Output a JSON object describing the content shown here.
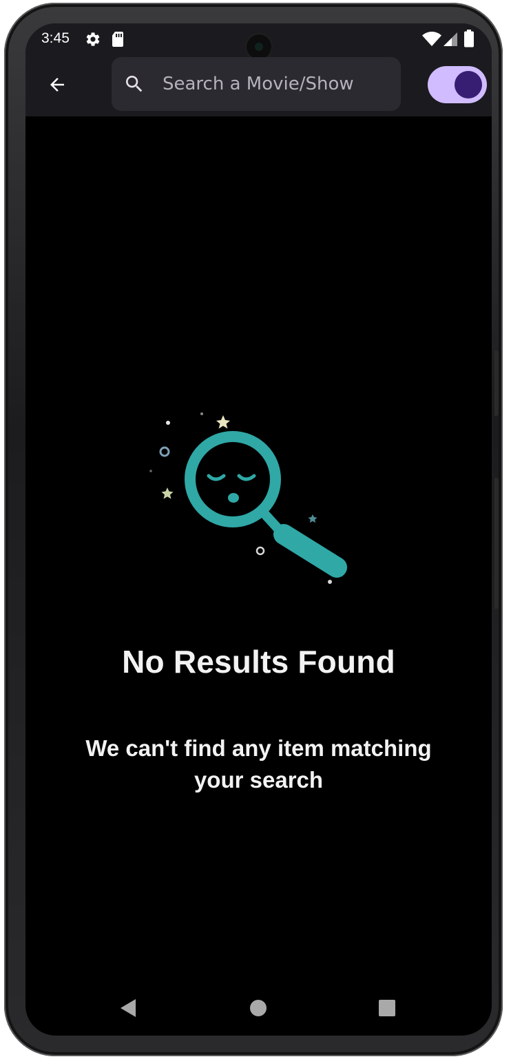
{
  "status_bar": {
    "time": "3:45",
    "icons": [
      "gear-icon",
      "sd-card-icon",
      "wifi-icon",
      "cellular-signal-icon",
      "battery-icon"
    ]
  },
  "app_bar": {
    "back_icon": "arrow-left-icon",
    "search": {
      "placeholder": "Search a Movie/Show",
      "value": "",
      "icon": "search-icon"
    },
    "toggle": {
      "state": "on",
      "track_color": "#d0bcff",
      "thumb_color": "#381e72"
    }
  },
  "empty_state": {
    "illustration": "sleeping-magnifier-icon",
    "title": "No Results Found",
    "message": "We can't find any item matching your search",
    "accent_color": "#2fa8a6"
  },
  "nav_bar": {
    "back": "triangle-back-icon",
    "home": "circle-home-icon",
    "recents": "square-recents-icon"
  }
}
